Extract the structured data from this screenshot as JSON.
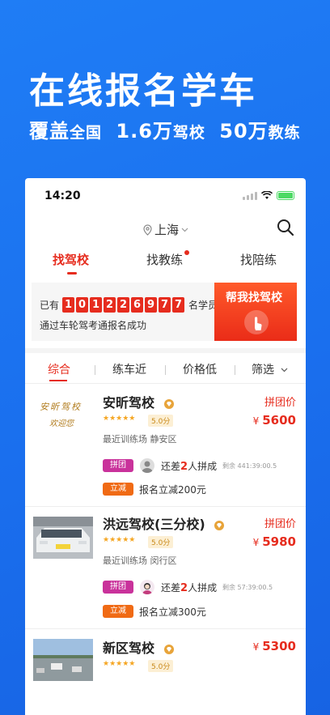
{
  "hero": {
    "title": "在线报名学车",
    "subtitle_a": "覆盖",
    "subtitle_b": "全国",
    "subtitle_c": "1.6万",
    "subtitle_d": "驾校",
    "subtitle_e": "50万",
    "subtitle_f": "教练"
  },
  "status": {
    "time": "14:20"
  },
  "location": {
    "city": "上海"
  },
  "tabs": [
    {
      "label": "找驾校"
    },
    {
      "label": "找教练"
    },
    {
      "label": "找陪练"
    }
  ],
  "banner": {
    "prefix": "已有",
    "digits": [
      "1",
      "0",
      "1",
      "2",
      "2",
      "6",
      "9",
      "7",
      "7"
    ],
    "suffix": "名学员",
    "subtext": "通过车轮驾考通报名成功",
    "button": "帮我找驾校"
  },
  "filters": [
    {
      "label": "综合"
    },
    {
      "label": "练车近"
    },
    {
      "label": "价格低"
    },
    {
      "label": "筛选"
    }
  ],
  "schools": [
    {
      "name": "安昕驾校",
      "logo_text_1": "安昕驾校",
      "logo_text_2": "欢迎您",
      "stars": "★★★★★",
      "score": "5.0分",
      "area": "最近训练场 静安区",
      "price_label": "拼团价",
      "currency": "¥",
      "price": "5600",
      "group_tag": "拼团",
      "need_prefix": "还差",
      "need_num": "2",
      "need_suffix": "人拼成",
      "remain": "剩余 441:39:00.5",
      "discount_tag": "立减",
      "discount": "报名立减200元"
    },
    {
      "name": "洪远驾校(三分校)",
      "stars": "★★★★★",
      "score": "5.0分",
      "area": "最近训练场 闵行区",
      "price_label": "拼团价",
      "currency": "¥",
      "price": "5980",
      "group_tag": "拼团",
      "need_prefix": "还差",
      "need_num": "2",
      "need_suffix": "人拼成",
      "remain": "剩余 57:39:00.5",
      "discount_tag": "立减",
      "discount": "报名立减300元"
    },
    {
      "name": "新区驾校",
      "stars": "★★★★★",
      "score": "5.0分",
      "currency": "¥",
      "price": "5300"
    }
  ],
  "colors": {
    "accent": "#e62c1e",
    "background": "#1f7df5",
    "group_tag": "#c9329b",
    "discount_tag": "#f06a14"
  }
}
